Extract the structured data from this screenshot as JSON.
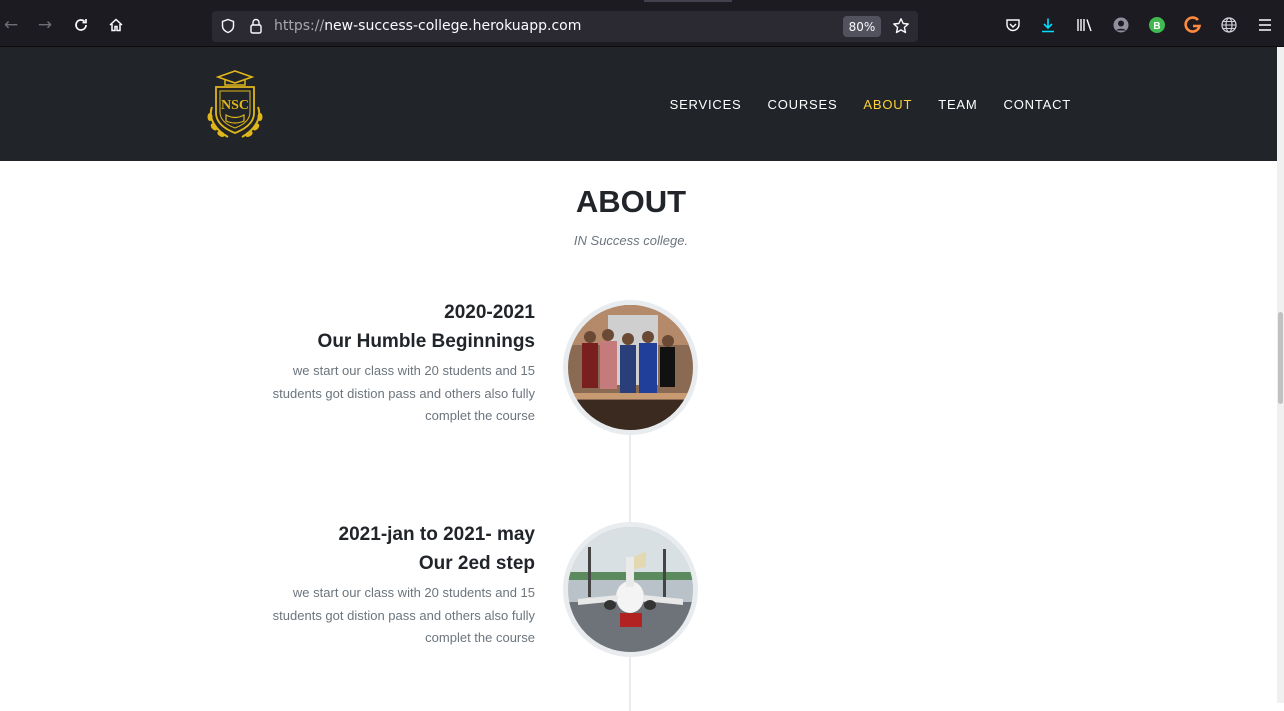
{
  "browser": {
    "url_protocol": "https://",
    "url_host": "new-success-college.herokuapp.com",
    "zoom": "80%",
    "profile_badge": "B"
  },
  "site": {
    "logo_text": "NSC",
    "nav": [
      {
        "label": "SERVICES",
        "active": false
      },
      {
        "label": "COURSES",
        "active": false
      },
      {
        "label": "ABOUT",
        "active": true
      },
      {
        "label": "TEAM",
        "active": false
      },
      {
        "label": "CONTACT",
        "active": false
      }
    ],
    "accent_color": "#fed136",
    "header_bg": "#212529"
  },
  "about": {
    "title": "ABOUT",
    "subtitle": "IN Success college.",
    "timeline": [
      {
        "year": "2020-2021",
        "heading": "Our Humble Beginnings",
        "body": "we start our class with 20 students and 15 students got distion pass and others also fully complet the course",
        "image": "group-photo"
      },
      {
        "year": "2021-jan to 2021- may",
        "heading": "Our 2ed step",
        "body": "we start our class with 20 students and 15 students got distion pass and others also fully complet the course",
        "image": "airplane-photo"
      }
    ]
  }
}
